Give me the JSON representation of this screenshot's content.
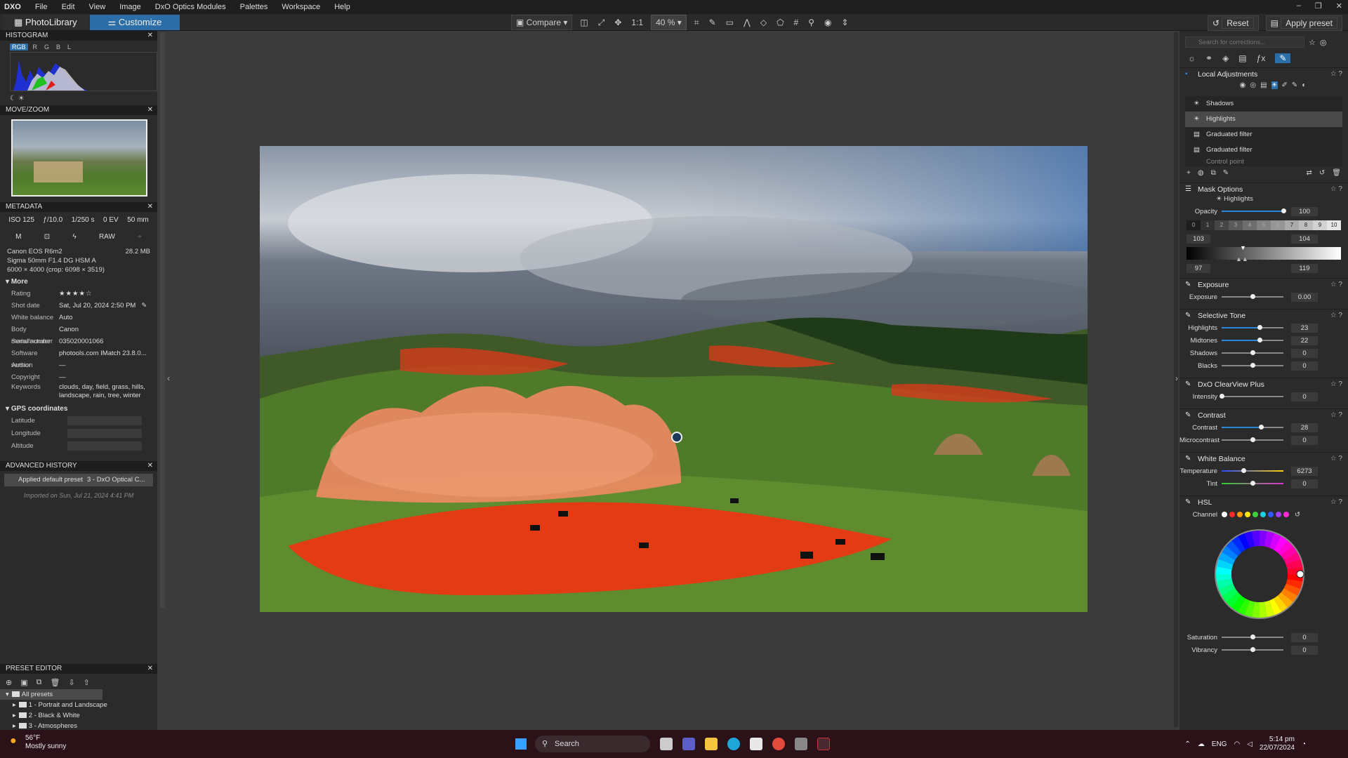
{
  "menubar": {
    "logo": "DXO",
    "items": [
      "File",
      "Edit",
      "View",
      "Image",
      "DxO Optics Modules",
      "Palettes",
      "Workspace",
      "Help"
    ]
  },
  "tabs": {
    "photolibrary": "PhotoLibrary",
    "customize": "Customize"
  },
  "toolbar": {
    "compare": "Compare",
    "ratio": "1:1",
    "zoom": "40 %",
    "reset": "Reset",
    "apply_preset": "Apply preset"
  },
  "histogram": {
    "title": "HISTOGRAM",
    "channels": [
      "RGB",
      "R",
      "G",
      "B",
      "L"
    ]
  },
  "movezoom": {
    "title": "MOVE/ZOOM"
  },
  "metadata": {
    "title": "METADATA",
    "exif": [
      "ISO 125",
      "ƒ/10.0",
      "1/250 s",
      "0 EV",
      "50 mm"
    ],
    "modes": [
      "M",
      "RAW"
    ],
    "camera": "Canon EOS R6m2",
    "filesize": "28.2 MB",
    "lens": "Sigma 50mm F1.4 DG HSM A",
    "dimensions": "6000 × 4000 (crop: 6098 × 3519)",
    "more": "More",
    "rows": [
      {
        "label": "Rating",
        "value": "★★★★☆"
      },
      {
        "label": "Shot date",
        "value": "Sat, Jul 20, 2024 2:50 PM"
      },
      {
        "label": "White balance",
        "value": "Auto"
      },
      {
        "label": "Body manufacturer",
        "value": "Canon"
      },
      {
        "label": "Serial number",
        "value": "035020001066"
      },
      {
        "label": "Software version",
        "value": "photools.com IMatch 23.8.0..."
      },
      {
        "label": "Author",
        "value": "—"
      },
      {
        "label": "Copyright",
        "value": "—"
      },
      {
        "label": "Keywords",
        "value": "clouds, day, field, grass, hills,"
      },
      {
        "label": "",
        "value": "landscape, rain, tree, winter"
      }
    ],
    "gps": "GPS coordinates",
    "gps_rows": [
      "Latitude",
      "Longitude",
      "Altitude"
    ]
  },
  "history": {
    "title": "ADVANCED HISTORY",
    "item_label": "Applied default preset",
    "item_value": "3 - DxO Optical C...",
    "imported": "Imported on Sun, Jul 21, 2024 4:41 PM"
  },
  "preset_editor": {
    "title": "PRESET EDITOR",
    "tree": [
      "All presets",
      "1 - Portrait and Landscape",
      "2 - Black & White",
      "3 - Atmospheres"
    ]
  },
  "right": {
    "search_placeholder": "Search for corrections...",
    "local_adjustments": "Local Adjustments",
    "la_items": [
      "Shadows",
      "Highlights",
      "Graduated filter",
      "Graduated filter",
      "Control point"
    ],
    "mask_options": "Mask Options",
    "mask_name": "Highlights",
    "opacity": {
      "label": "Opacity",
      "value": "100",
      "level": 1.0
    },
    "zones": [
      "0",
      "1",
      "2",
      "3",
      "4",
      "5",
      "6",
      "7",
      "8",
      "9",
      "10"
    ],
    "range": {
      "low_in": "103",
      "high_in": "104",
      "low_out": "97",
      "high_out": "119"
    },
    "exposure": {
      "title": "Exposure",
      "label": "Exposure",
      "value": "0.00",
      "level": 0.5
    },
    "selective_tone": {
      "title": "Selective Tone",
      "rows": [
        {
          "label": "Highlights",
          "value": "23",
          "level": 0.615
        },
        {
          "label": "Midtones",
          "value": "22",
          "level": 0.61
        },
        {
          "label": "Shadows",
          "value": "0",
          "level": 0.5
        },
        {
          "label": "Blacks",
          "value": "0",
          "level": 0.5
        }
      ]
    },
    "clearview": {
      "title": "DxO ClearView Plus",
      "label": "Intensity",
      "value": "0",
      "level": 0
    },
    "contrast": {
      "title": "Contrast",
      "rows": [
        {
          "label": "Contrast",
          "value": "28",
          "level": 0.64
        },
        {
          "label": "Microcontrast",
          "value": "0",
          "level": 0.5
        }
      ]
    },
    "white_balance": {
      "title": "White Balance",
      "rows": [
        {
          "label": "Temperature",
          "value": "6273",
          "level": 0.35
        },
        {
          "label": "Tint",
          "value": "0",
          "level": 0.5
        }
      ]
    },
    "hsl": {
      "title": "HSL",
      "channel": "Channel",
      "channel_colors": [
        "#ffffff",
        "#ff2a2a",
        "#ff9a00",
        "#ffe600",
        "#3ad13a",
        "#20d0e0",
        "#2f5bff",
        "#a83cff",
        "#ff2ad0"
      ]
    },
    "bottom": [
      {
        "label": "Saturation",
        "value": "0",
        "level": 0.5
      },
      {
        "label": "Vibrancy",
        "value": "0",
        "level": 0.5
      }
    ]
  },
  "taskbar": {
    "temp": "56°F",
    "weather": "Mostly sunny",
    "search": "Search",
    "lang": "ENG",
    "time": "5:14 pm",
    "date": "22/07/2024"
  }
}
